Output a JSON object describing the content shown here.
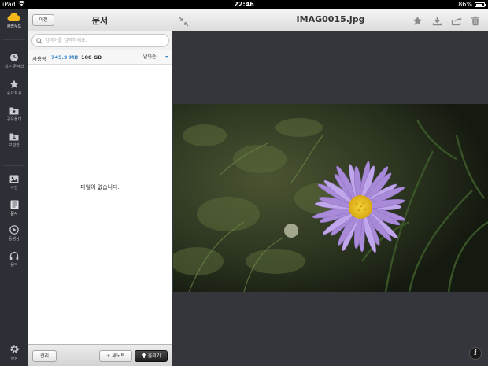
{
  "status_bar": {
    "carrier": "iPad",
    "time": "22:46",
    "battery_text": "86%",
    "battery_level": 0.86
  },
  "sidebar": {
    "brand": "클라우드",
    "items": [
      {
        "label": "최근 문서함",
        "icon": "clock-icon"
      },
      {
        "label": "중요표시",
        "icon": "star-icon"
      },
      {
        "label": "공유폴더",
        "icon": "shared-folder-icon"
      },
      {
        "label": "보관함",
        "icon": "archive-icon"
      },
      {
        "label": "사진",
        "icon": "photo-icon"
      },
      {
        "label": "문서",
        "icon": "document-icon"
      },
      {
        "label": "동영상",
        "icon": "video-icon"
      },
      {
        "label": "음악",
        "icon": "headphones-icon"
      }
    ],
    "settings_label": "설정"
  },
  "docs": {
    "back_label": "이전",
    "title": "문서",
    "search_placeholder": "검색어를 입력하세요.",
    "usage_label": "사용량",
    "usage_used": "745.9 MB",
    "usage_sep": "/",
    "usage_total": "100 GB",
    "sort_label": "날짜순",
    "empty_message": "파일이 없습니다.",
    "footer": {
      "manage_label": "관리",
      "new_note_label": "새노트",
      "upload_label": "올리기"
    }
  },
  "viewer": {
    "title": "IMAG0015.jpg",
    "info_label": "i",
    "accent_colors": {
      "petal": "#a88ad8",
      "center": "#f0cc1e",
      "foliage": "#2e3a22"
    }
  }
}
